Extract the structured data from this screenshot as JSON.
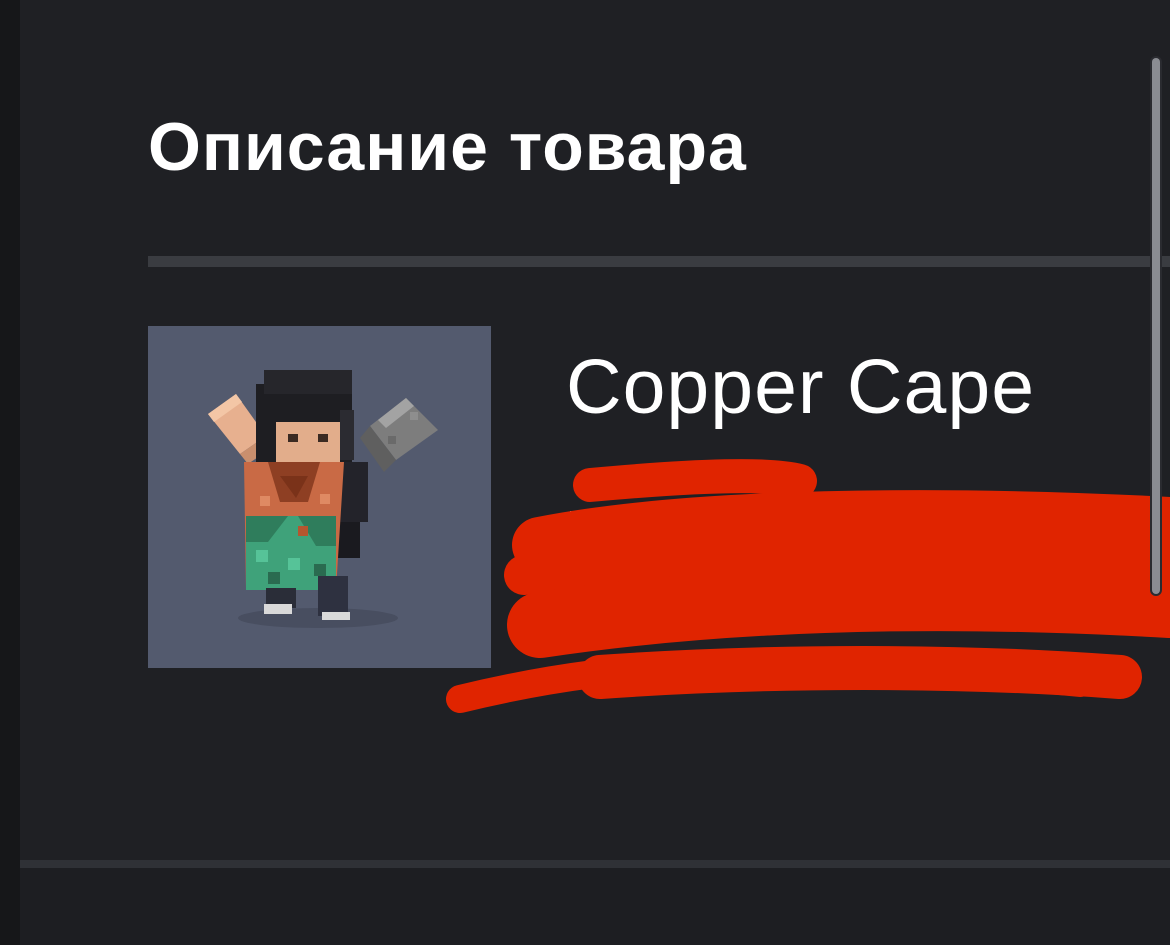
{
  "section": {
    "title": "Описание товара"
  },
  "product": {
    "name": "Copper Cape",
    "thumbnail_icon": "minecraft-character-with-copper-cape-image",
    "description_redacted": true
  },
  "colors": {
    "background": "#1f2024",
    "divider": "#3a3c41",
    "thumbnail_bg": "#535a6e",
    "redaction": "#e02400",
    "text": "#ffffff"
  }
}
